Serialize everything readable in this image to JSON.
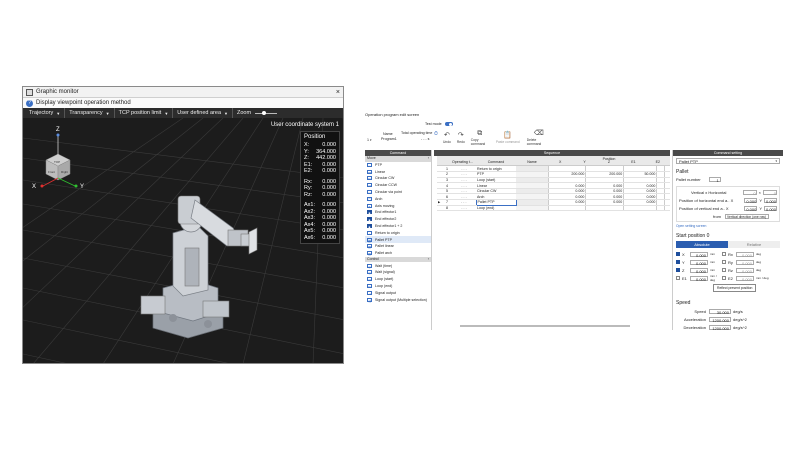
{
  "graphic_monitor": {
    "title": "Graphic monitor",
    "close_glyph": "×",
    "view_label": "Display viewpoint operation method",
    "toolbar": {
      "trajectory": "Trajectory",
      "transparency": "Transparency",
      "tcp_limit": "TCP position limit",
      "user_area": "User defined area",
      "zoom": "Zoom",
      "zoom_level": 0.4
    },
    "coord_system": "User coordinate system 1",
    "axes_labels": {
      "z": "Z",
      "x": "X",
      "y": "Y",
      "top": "TOP",
      "right": "Right",
      "front": "Front"
    },
    "position": {
      "heading": "Position",
      "rows_xyz": [
        {
          "k": "X:",
          "v": "0.000"
        },
        {
          "k": "Y:",
          "v": "364.000"
        },
        {
          "k": "Z:",
          "v": "442.000"
        },
        {
          "k": "E1:",
          "v": "0.000"
        },
        {
          "k": "E2:",
          "v": "0.000"
        }
      ],
      "rows_rot": [
        {
          "k": "Rx:",
          "v": "0.000"
        },
        {
          "k": "Ry:",
          "v": "0.000"
        },
        {
          "k": "Rz:",
          "v": "0.000"
        }
      ],
      "rows_axis": [
        {
          "k": "Ax1:",
          "v": "0.000"
        },
        {
          "k": "Ax2:",
          "v": "0.000"
        },
        {
          "k": "Ax3:",
          "v": "0.000"
        },
        {
          "k": "Ax4:",
          "v": "0.000"
        },
        {
          "k": "Ax5:",
          "v": "0.000"
        },
        {
          "k": "Ax6:",
          "v": "0.000"
        }
      ]
    }
  },
  "op_screen": {
    "title": "Operation program edit screen",
    "test_mode": "Test mode",
    "name_label": "Name",
    "name_value": "Program1",
    "program_no": "1",
    "total_time_label": "Total operating time",
    "total_time_value": "- - -  s",
    "toolbar": {
      "undo": "Undo",
      "redo": "Redo",
      "copy": "Copy command",
      "paste": "Paste command",
      "delete": "Delete command"
    },
    "panels": {
      "command": "Command",
      "sequence": "Sequence",
      "setting": "Command setting"
    },
    "categories": {
      "move": "Move",
      "control": "Control"
    },
    "move_commands": [
      {
        "label": "PTP",
        "icon": "⤳"
      },
      {
        "label": "Linear",
        "icon": "⟶"
      },
      {
        "label": "Circular CW",
        "icon": "↻"
      },
      {
        "label": "Circular CCW",
        "icon": "↺"
      },
      {
        "label": "Circular via point",
        "icon": "◠"
      },
      {
        "label": "Arch",
        "icon": "⌒"
      },
      {
        "label": "Axis moving",
        "icon": "⇅"
      },
      {
        "label": "End effector1",
        "icon": "■",
        "filled": true
      },
      {
        "label": "End effector2",
        "icon": "■",
        "filled": true
      },
      {
        "label": "End effector1 + 2",
        "icon": "■",
        "filled": true
      },
      {
        "label": "Return to origin",
        "icon": "⌂"
      },
      {
        "label": "Pallet PTP",
        "icon": "▦",
        "selected": true
      },
      {
        "label": "Pallet linear",
        "icon": "▦"
      },
      {
        "label": "Pallet arch",
        "icon": "▦"
      }
    ],
    "control_commands": [
      {
        "label": "Wait (time)",
        "icon": "◷"
      },
      {
        "label": "Wait (signal)",
        "icon": "◷"
      },
      {
        "label": "Loop (start)",
        "icon": "↺"
      },
      {
        "label": "Loop (end)",
        "icon": "↻"
      },
      {
        "label": "Signal output",
        "icon": "⇥"
      },
      {
        "label": "Signal output (Multiple selection)",
        "icon": "⇶"
      }
    ],
    "sequence": {
      "headers": {
        "operating": "Operating t...",
        "command": "Command",
        "name": "Name",
        "position": "Position",
        "cols": [
          "X",
          "Y",
          "Z",
          "E1",
          "E2"
        ]
      },
      "rows": [
        {
          "no": "1",
          "cmd": "Return to origin",
          "name": "",
          "vals": [
            "",
            "",
            "",
            "",
            ""
          ]
        },
        {
          "no": "2",
          "cmd": "PTP",
          "name": "",
          "vals": [
            "200.000",
            "200.000",
            "50.000",
            "",
            ""
          ]
        },
        {
          "no": "3",
          "cmd": "Loop (start)",
          "name": "",
          "vals": [
            "",
            "",
            "",
            "",
            ""
          ]
        },
        {
          "no": "4",
          "cmd": "Linear",
          "name": "",
          "vals": [
            "0.000",
            "0.000",
            "0.000",
            "",
            ""
          ]
        },
        {
          "no": "5",
          "cmd": "Circular CW",
          "name": "",
          "vals": [
            "0.000",
            "0.000",
            "0.000",
            "",
            ""
          ]
        },
        {
          "no": "6",
          "cmd": "Arch",
          "name": "",
          "vals": [
            "0.000",
            "0.000",
            "0.000",
            "",
            ""
          ]
        },
        {
          "no": "7",
          "cmd": "Pallet PTP",
          "name": "",
          "vals": [
            "0.000",
            "0.000",
            "0.000",
            "",
            ""
          ],
          "current": true
        },
        {
          "no": "8",
          "cmd": "Loop (end)",
          "name": "",
          "vals": [
            "",
            "",
            "",
            "",
            ""
          ]
        }
      ]
    },
    "setting": {
      "dropdown": "Pallet PTP",
      "pallet_heading": "Pallet",
      "pallet_number_label": "Pallet number",
      "pallet_number": "1",
      "vert_label": "Vertical x Horizontal",
      "vert_a": "0",
      "vert_x": "×",
      "vert_b": "0",
      "pos_h_label": "Position of horizontal end a.. X",
      "pos_v_label": "Position of vertical end a.. X",
      "y_label": "Y",
      "pos_h_x": "0.000",
      "pos_h_y": "0.000",
      "pos_v_x": "0.000",
      "pos_v_y": "0.000",
      "from_label": "from",
      "from_value": "Vertical direction (one row)",
      "open_link": "Open setting screen",
      "start_heading": "Start position 0",
      "tab_absolute": "Absolute",
      "tab_relative": "Relative",
      "pos_rows": [
        {
          "k": "X",
          "v": "0.000",
          "u": "mm",
          "rk": "Rx",
          "rv": "0.000",
          "ru": "deg",
          "on": true
        },
        {
          "k": "Y",
          "v": "0.000",
          "u": "mm",
          "rk": "Ry",
          "rv": "0.000",
          "ru": "deg",
          "on": true
        },
        {
          "k": "Z",
          "v": "0.000",
          "u": "mm",
          "rk": "Rz",
          "rv": "0.000",
          "ru": "deg",
          "on": true
        },
        {
          "k": "E1",
          "v": "0.000",
          "u": "mm / deg",
          "rk": "E2",
          "rv": "0.000",
          "ru": "mm / deg",
          "on": false
        }
      ],
      "reflect": "Reflect present position",
      "speed_heading": "Speed",
      "speed_label": "Speed",
      "speed_value": "30.000",
      "speed_unit": "deg/s",
      "accel_label": "Acceleration",
      "accel_value": "1200.000",
      "accel_unit": "deg/s^2",
      "decel_label": "Deceleration",
      "decel_value": "1200.000",
      "decel_unit": "deg/s^2"
    }
  },
  "colors": {
    "accent": "#1e4e9c",
    "tab_active": "#2a5db0",
    "toggle": "#3a6fc4"
  }
}
